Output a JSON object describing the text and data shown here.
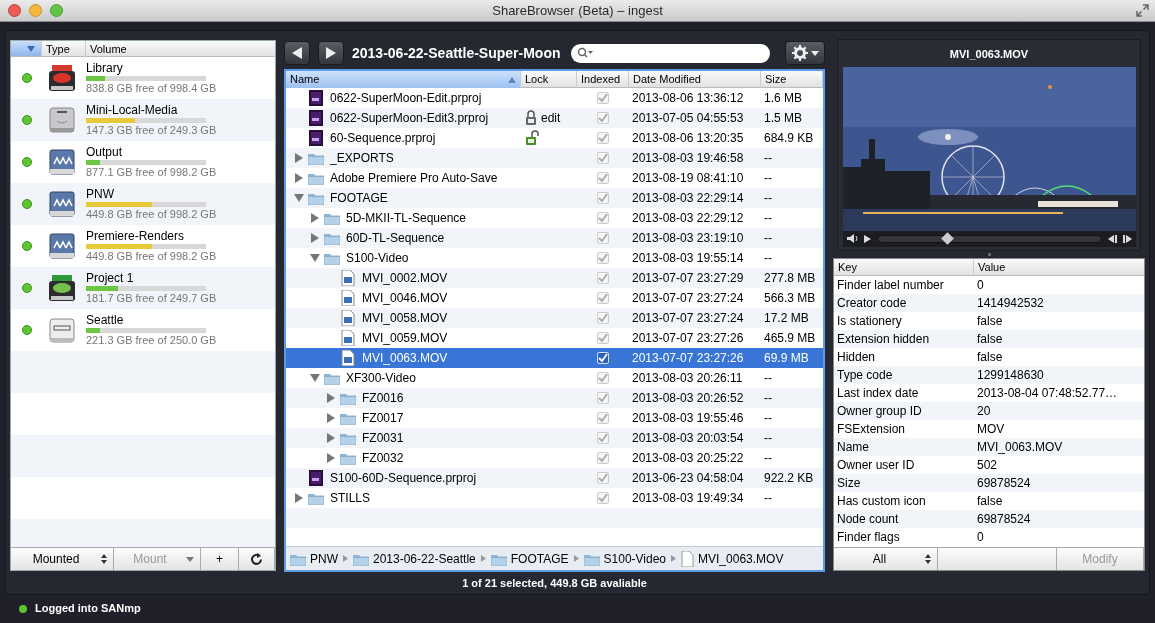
{
  "window": {
    "title": "ShareBrowser (Beta) – ingest"
  },
  "volumes": {
    "columns": [
      "Type",
      "Volume"
    ],
    "items": [
      {
        "name": "Library",
        "kind": "san_ro",
        "mounted": true,
        "level": 0.16,
        "color": "#6cc644",
        "reading": "838.8 GB free of 998.4 GB"
      },
      {
        "name": "Mini-Local-Media",
        "kind": "hdd",
        "mounted": true,
        "level": 0.41,
        "color": "#e8c93a",
        "reading": "147.3 GB free of 249.3 GB"
      },
      {
        "name": "Output",
        "kind": "network",
        "mounted": true,
        "level": 0.12,
        "color": "#6cc644",
        "reading": "877.1 GB free of 998.2 GB"
      },
      {
        "name": "PNW",
        "kind": "network",
        "mounted": true,
        "level": 0.55,
        "color": "#e8c93a",
        "reading": "449.8 GB free of 998.2 GB"
      },
      {
        "name": "Premiere-Renders",
        "kind": "network",
        "mounted": true,
        "level": 0.55,
        "color": "#e8c93a",
        "reading": "449.8 GB free of 998.2 GB"
      },
      {
        "name": "Project 1",
        "kind": "san_rw",
        "mounted": true,
        "level": 0.27,
        "color": "#6cc644",
        "reading": "181.7 GB free of 249.7 GB"
      },
      {
        "name": "Seattle",
        "kind": "evo",
        "mounted": true,
        "level": 0.12,
        "color": "#6cc644",
        "reading": "221.3 GB free of 250.0 GB"
      }
    ],
    "buttons": [
      {
        "label": "Mounted",
        "kind": "popup",
        "disabled": false
      },
      {
        "label": "Mount",
        "kind": "pulldown",
        "disabled": true
      },
      {
        "label": "+",
        "kind": "plain",
        "disabled": false
      },
      {
        "kind": "refresh",
        "disabled": false
      }
    ]
  },
  "browser": {
    "path_title": "2013-06-22-Seattle-Super-Moon",
    "columns": [
      {
        "label": "Name",
        "sorted": true
      },
      {
        "label": "Lock",
        "sorted": false
      },
      {
        "label": "Indexed",
        "sorted": false
      },
      {
        "label": "Date Modified",
        "sorted": false
      },
      {
        "label": "Size",
        "sorted": false
      }
    ],
    "rows": [
      {
        "name": "0622-SuperMoon-Edit.prproj",
        "kind": "project",
        "indexed": true,
        "date": "2013-08-06 13:36:12",
        "size": "1.6 MB",
        "selected": false
      },
      {
        "name": "0622-SuperMoon-Edit3.prproj",
        "kind": "project",
        "locked": true,
        "lock_label": "edit",
        "indexed": true,
        "date": "2013-07-05 04:55:53",
        "size": "1.5 MB",
        "selected": false
      },
      {
        "name": "60-Sequence.prproj",
        "kind": "project",
        "locked": false,
        "indexed": true,
        "date": "2013-08-06 13:20:35",
        "size": "684.9 KB",
        "selected": false
      },
      {
        "name": "_EXPORTS",
        "kind": "folder",
        "expanded": false,
        "indexed": true,
        "date": "2013-08-03 19:46:58",
        "size": "--",
        "selected": false
      },
      {
        "name": "Adobe Premiere Pro Auto-Save",
        "kind": "folder",
        "expanded": false,
        "indexed": true,
        "date": "2013-08-19 08:41:10",
        "size": "--",
        "selected": false
      },
      {
        "name": "FOOTAGE",
        "kind": "folder",
        "expanded": true,
        "indexed": true,
        "date": "2013-08-03 22:29:14",
        "size": "--",
        "selected": false,
        "children": [
          {
            "name": "5D-MKII-TL-Sequence",
            "kind": "folder",
            "expanded": false,
            "indexed": true,
            "date": "2013-08-03 22:29:12",
            "size": "--",
            "selected": false
          },
          {
            "name": "60D-TL-Sequence",
            "kind": "folder",
            "expanded": false,
            "indexed": true,
            "date": "2013-08-03 23:19:10",
            "size": "--",
            "selected": false
          },
          {
            "name": "S100-Video",
            "kind": "folder",
            "expanded": true,
            "indexed": true,
            "date": "2013-08-03 19:55:14",
            "size": "--",
            "selected": false,
            "children": [
              {
                "name": "MVI_0002.MOV",
                "kind": "movie",
                "indexed": true,
                "date": "2013-07-07 23:27:29",
                "size": "277.8 MB",
                "selected": false
              },
              {
                "name": "MVI_0046.MOV",
                "kind": "movie",
                "indexed": true,
                "date": "2013-07-07 23:27:24",
                "size": "566.3 MB",
                "selected": false
              },
              {
                "name": "MVI_0058.MOV",
                "kind": "movie",
                "indexed": true,
                "date": "2013-07-07 23:27:24",
                "size": "17.2 MB",
                "selected": false
              },
              {
                "name": "MVI_0059.MOV",
                "kind": "movie",
                "indexed": true,
                "date": "2013-07-07 23:27:26",
                "size": "465.9 MB",
                "selected": false
              },
              {
                "name": "MVI_0063.MOV",
                "kind": "movie",
                "indexed": true,
                "date": "2013-07-07 23:27:26",
                "size": "69.9 MB",
                "selected": true
              }
            ]
          },
          {
            "name": "XF300-Video",
            "kind": "folder",
            "expanded": true,
            "indexed": true,
            "date": "2013-08-03 20:26:11",
            "size": "--",
            "selected": false,
            "children": [
              {
                "name": "FZ0016",
                "kind": "folder",
                "expanded": false,
                "indexed": true,
                "date": "2013-08-03 20:26:52",
                "size": "--",
                "selected": false
              },
              {
                "name": "FZ0017",
                "kind": "folder",
                "expanded": false,
                "indexed": true,
                "date": "2013-08-03 19:55:46",
                "size": "--",
                "selected": false
              },
              {
                "name": "FZ0031",
                "kind": "folder",
                "expanded": false,
                "indexed": true,
                "date": "2013-08-03 20:03:54",
                "size": "--",
                "selected": false
              },
              {
                "name": "FZ0032",
                "kind": "folder",
                "expanded": false,
                "indexed": true,
                "date": "2013-08-03 20:25:22",
                "size": "--",
                "selected": false
              }
            ]
          }
        ]
      },
      {
        "name": "S100-60D-Sequence.prproj",
        "kind": "project",
        "indexed": true,
        "date": "2013-06-23 04:58:04",
        "size": "922.2 KB",
        "selected": false
      },
      {
        "name": "STILLS",
        "kind": "folder",
        "expanded": false,
        "indexed": true,
        "date": "2013-08-03 19:49:34",
        "size": "--",
        "selected": false
      }
    ],
    "breadcrumb": [
      {
        "label": "PNW",
        "kind": "folder"
      },
      {
        "label": "2013-06-22-Seattle",
        "kind": "folder"
      },
      {
        "label": "FOOTAGE",
        "kind": "folder"
      },
      {
        "label": "S100-Video",
        "kind": "folder"
      },
      {
        "label": "MVI_0063.MOV",
        "kind": "file"
      }
    ],
    "status": "1 of 21 selected, 449.8 GB avaliable"
  },
  "preview": {
    "title": "MVI_0063.MOV",
    "player": {
      "level": 0.31
    }
  },
  "properties": {
    "columns": [
      "Key",
      "Value"
    ],
    "rows": [
      {
        "key": "Finder label number",
        "value": "0"
      },
      {
        "key": "Creator code",
        "value": "1414942532"
      },
      {
        "key": "Is stationery",
        "value": "false"
      },
      {
        "key": "Extension hidden",
        "value": "false"
      },
      {
        "key": "Hidden",
        "value": "false"
      },
      {
        "key": "Type code",
        "value": "1299148630"
      },
      {
        "key": "Last index date",
        "value": "2013-08-04 07:48:52.77…"
      },
      {
        "key": "Owner group ID",
        "value": "20"
      },
      {
        "key": "FSExtension",
        "value": "MOV"
      },
      {
        "key": "Name",
        "value": "MVI_0063.MOV"
      },
      {
        "key": "Owner user ID",
        "value": "502"
      },
      {
        "key": "Size",
        "value": "69878524"
      },
      {
        "key": "Has custom icon",
        "value": "false"
      },
      {
        "key": "Node count",
        "value": "69878524"
      },
      {
        "key": "Finder flags",
        "value": "0"
      }
    ],
    "buttons": [
      {
        "label": "All",
        "kind": "popup",
        "disabled": false
      },
      {
        "label": "Modify",
        "kind": "plain",
        "disabled": true
      }
    ]
  },
  "status_bar": {
    "text": "Logged into SANmp",
    "connected": true
  }
}
